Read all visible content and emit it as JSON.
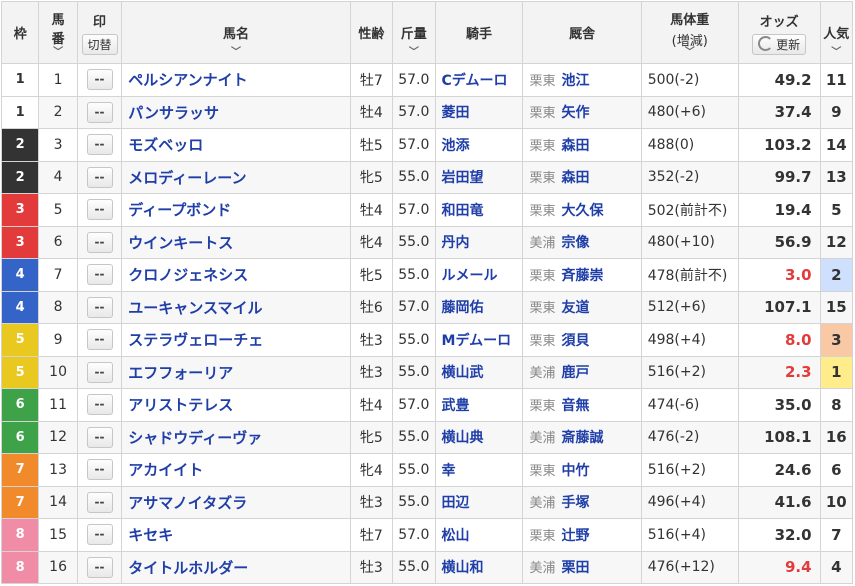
{
  "header": {
    "waku": "枠",
    "umaban_line1": "馬",
    "umaban_line2": "番",
    "mark": "印",
    "mark_toggle": "切替",
    "horse_name": "馬名",
    "sex_age": "性齢",
    "kinryo": "斤量",
    "jockey": "騎手",
    "stable": "厩舎",
    "body_weight": "馬体重",
    "body_weight_sub": "(増減)",
    "odds": "オッズ",
    "odds_refresh": "更新",
    "popularity": "人気",
    "sort_icon": "chevron-down-icon"
  },
  "rows": [
    {
      "waku": "1",
      "num": "1",
      "mark": "--",
      "name": "ペルシアンナイト",
      "sex_age": "牡7",
      "kinryo": "57.0",
      "jockey": "Cデムーロ",
      "region": "栗東",
      "trainer": "池江",
      "weight": "500(-2)",
      "odds": "49.2",
      "pop": "11"
    },
    {
      "waku": "1",
      "num": "2",
      "mark": "--",
      "name": "パンサラッサ",
      "sex_age": "牡4",
      "kinryo": "57.0",
      "jockey": "菱田",
      "region": "栗東",
      "trainer": "矢作",
      "weight": "480(+6)",
      "odds": "37.4",
      "pop": "9"
    },
    {
      "waku": "2",
      "num": "3",
      "mark": "--",
      "name": "モズベッロ",
      "sex_age": "牡5",
      "kinryo": "57.0",
      "jockey": "池添",
      "region": "栗東",
      "trainer": "森田",
      "weight": "488(0)",
      "odds": "103.2",
      "pop": "14"
    },
    {
      "waku": "2",
      "num": "4",
      "mark": "--",
      "name": "メロディーレーン",
      "sex_age": "牝5",
      "kinryo": "55.0",
      "jockey": "岩田望",
      "region": "栗東",
      "trainer": "森田",
      "weight": "352(-2)",
      "odds": "99.7",
      "pop": "13"
    },
    {
      "waku": "3",
      "num": "5",
      "mark": "--",
      "name": "ディープボンド",
      "sex_age": "牡4",
      "kinryo": "57.0",
      "jockey": "和田竜",
      "region": "栗東",
      "trainer": "大久保",
      "weight": "502(前計不)",
      "odds": "19.4",
      "pop": "5"
    },
    {
      "waku": "3",
      "num": "6",
      "mark": "--",
      "name": "ウインキートス",
      "sex_age": "牝4",
      "kinryo": "55.0",
      "jockey": "丹内",
      "region": "美浦",
      "trainer": "宗像",
      "weight": "480(+10)",
      "odds": "56.9",
      "pop": "12"
    },
    {
      "waku": "4",
      "num": "7",
      "mark": "--",
      "name": "クロノジェネシス",
      "sex_age": "牝5",
      "kinryo": "55.0",
      "jockey": "ルメール",
      "region": "栗東",
      "trainer": "斉藤崇",
      "weight": "478(前計不)",
      "odds": "3.0",
      "pop": "2"
    },
    {
      "waku": "4",
      "num": "8",
      "mark": "--",
      "name": "ユーキャンスマイル",
      "sex_age": "牡6",
      "kinryo": "57.0",
      "jockey": "藤岡佑",
      "region": "栗東",
      "trainer": "友道",
      "weight": "512(+6)",
      "odds": "107.1",
      "pop": "15"
    },
    {
      "waku": "5",
      "num": "9",
      "mark": "--",
      "name": "ステラヴェローチェ",
      "sex_age": "牡3",
      "kinryo": "55.0",
      "jockey": "Mデムーロ",
      "region": "栗東",
      "trainer": "須貝",
      "weight": "498(+4)",
      "odds": "8.0",
      "pop": "3"
    },
    {
      "waku": "5",
      "num": "10",
      "mark": "--",
      "name": "エフフォーリア",
      "sex_age": "牡3",
      "kinryo": "55.0",
      "jockey": "横山武",
      "region": "美浦",
      "trainer": "鹿戸",
      "weight": "516(+2)",
      "odds": "2.3",
      "pop": "1"
    },
    {
      "waku": "6",
      "num": "11",
      "mark": "--",
      "name": "アリストテレス",
      "sex_age": "牡4",
      "kinryo": "57.0",
      "jockey": "武豊",
      "region": "栗東",
      "trainer": "音無",
      "weight": "474(-6)",
      "odds": "35.0",
      "pop": "8"
    },
    {
      "waku": "6",
      "num": "12",
      "mark": "--",
      "name": "シャドウディーヴァ",
      "sex_age": "牝5",
      "kinryo": "55.0",
      "jockey": "横山典",
      "region": "美浦",
      "trainer": "斎藤誠",
      "weight": "476(-2)",
      "odds": "108.1",
      "pop": "16"
    },
    {
      "waku": "7",
      "num": "13",
      "mark": "--",
      "name": "アカイイト",
      "sex_age": "牝4",
      "kinryo": "55.0",
      "jockey": "幸",
      "region": "栗東",
      "trainer": "中竹",
      "weight": "516(+2)",
      "odds": "24.6",
      "pop": "6"
    },
    {
      "waku": "7",
      "num": "14",
      "mark": "--",
      "name": "アサマノイタズラ",
      "sex_age": "牡3",
      "kinryo": "55.0",
      "jockey": "田辺",
      "region": "美浦",
      "trainer": "手塚",
      "weight": "496(+4)",
      "odds": "41.6",
      "pop": "10"
    },
    {
      "waku": "8",
      "num": "15",
      "mark": "--",
      "name": "キセキ",
      "sex_age": "牡7",
      "kinryo": "57.0",
      "jockey": "松山",
      "region": "栗東",
      "trainer": "辻野",
      "weight": "516(+4)",
      "odds": "32.0",
      "pop": "7"
    },
    {
      "waku": "8",
      "num": "16",
      "mark": "--",
      "name": "タイトルホルダー",
      "sex_age": "牡3",
      "kinryo": "55.0",
      "jockey": "横山和",
      "region": "美浦",
      "trainer": "栗田",
      "weight": "476(+12)",
      "odds": "9.4",
      "pop": "4"
    }
  ],
  "colors": {
    "waku1": "#ffffff",
    "waku2": "#333333",
    "waku3": "#e33b3b",
    "waku4": "#3564c8",
    "waku5": "#e9c820",
    "waku6": "#3da248",
    "waku7": "#f08a2a",
    "waku8": "#f08ca5",
    "link": "#1f3ea8",
    "hot_odds": "#e33b3b",
    "pop1": "#ffec8a",
    "pop2": "#cfe0ff",
    "pop3": "#f8c9a4"
  }
}
